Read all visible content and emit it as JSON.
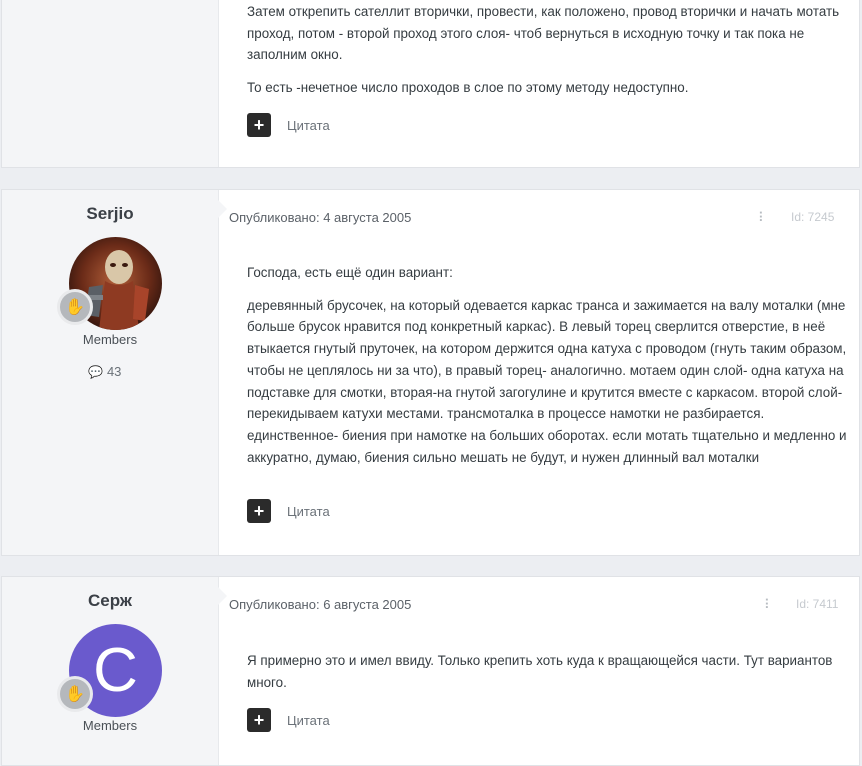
{
  "posts": [
    {
      "content": [
        "Затем открепить сателлит вторички, провести, как положено, провод вторички и начать мотать проход, потом - второй проход этого слоя- чтоб вернуться в исходную точку и так пока не заполним окно.",
        "То есть -нечетное число проходов в слое по этому методу недоступно."
      ],
      "quote_label": "Цитата"
    },
    {
      "author": "Serjio",
      "group": "Members",
      "post_count": "43",
      "posted": "Опубликовано: 4 августа 2005",
      "id_label": "Id: 7245",
      "content": [
        "Господа, есть ещё один вариант:",
        "деревянный брусочек, на который одевается каркас транса и зажимается на валу моталки (мне больше брусок нравится под конкретный каркас). В левый торец сверлится отверстие, в неё втыкается гнутый пруточек, на котором держится одна катуха с проводом (гнуть таким образом, чтобы не цеплялось ни за что), в правый торец- аналогично. мотаем один слой- одна катуха на подставке для смотки, вторая-на гнутой загогулине и крутится вместе с каркасом. второй слой-перекидываем катухи местами. трансмоталка в процессе намотки не разбирается. единственное- биения при намотке на больших оборотах. если мотать тщательно и медленно и аккуратно, думаю, биения сильно мешать не будут, и нужен длинный вал моталки"
      ],
      "quote_label": "Цитата"
    },
    {
      "author": "Серж",
      "avatar_letter": "С",
      "group": "Members",
      "posted": "Опубликовано: 6 августа 2005",
      "id_label": "Id: 7411",
      "content": [
        "Я примерно это и имел ввиду. Только крепить хоть куда к вращающейся части. Тут вариантов много."
      ],
      "quote_label": "Цитата"
    }
  ],
  "colors": {
    "avatar_c_bg": "#6a5acd",
    "plus_button_bg": "#2b2b2b",
    "author_column_bg": "#f4f5f7"
  },
  "icons": [
    "plus-icon",
    "share-icon",
    "comment-icon",
    "rank-hand-icon"
  ]
}
